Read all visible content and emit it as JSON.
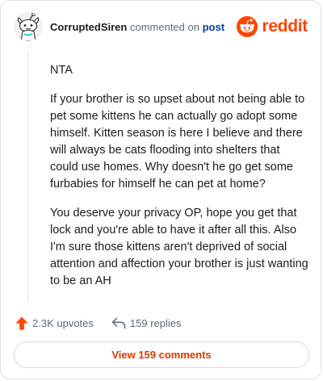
{
  "comment": {
    "username": "CorruptedSiren",
    "action_text": "commented on",
    "post_link_label": "post",
    "avatar_icon": "snoo-avatar-icon",
    "paragraphs": [
      "NTA",
      "If your brother is so upset about not being able to pet some kittens he can actually go adopt some himself. Kitten season is here I believe and there will always be cats flooding into shelters that could use homes. Why doesn't he go get some furbabies for himself he can pet at home?",
      "You deserve your privacy OP, hope you get that lock and you're able to have it after all this. Also I'm sure those kittens aren't deprived of social attention and affection your brother is just wanting to be an AH"
    ]
  },
  "brand": {
    "name": "reddit",
    "icon": "reddit-logo-icon",
    "color": "#ff4500"
  },
  "footer": {
    "upvotes_label": "2.3K upvotes",
    "upvote_icon": "upvote-arrow-icon",
    "upvote_color": "#ff4500",
    "replies_label": "159 replies",
    "reply_icon": "reply-arrow-icon"
  },
  "view_comments_label": "View 159 comments",
  "view_comments_color": "#d93a00"
}
